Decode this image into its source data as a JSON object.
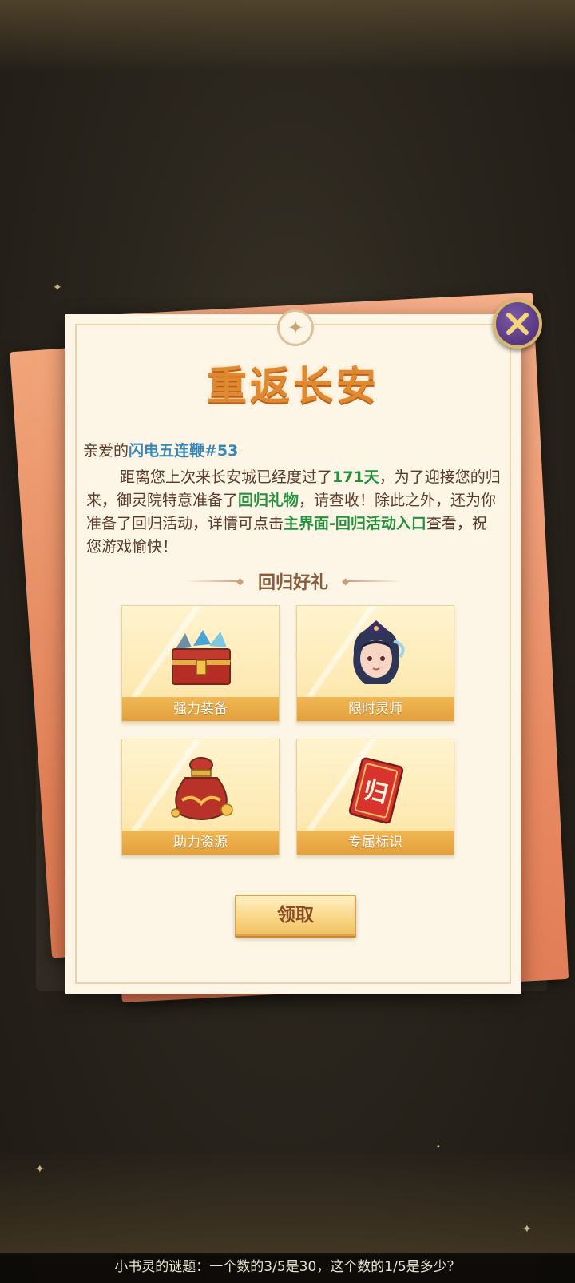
{
  "dialog": {
    "title": "重返长安",
    "greeting_prefix": "亲爱的",
    "player_name": "闪电五连鞭#53",
    "body": {
      "p1": "距离您上次来长安城已经度过了",
      "days": "171天",
      "p2": "，为了迎接您的归来，御灵院特意准备了",
      "gift": "回归礼物",
      "p3": "，请查收！除此之外，还为你准备了回归活动，详情可点击",
      "entry": "主界面-回归活动入口",
      "p4": "查看，祝您游戏愉快！"
    },
    "section_title": "回归好礼",
    "rewards": [
      {
        "label": "强力装备",
        "icon": "treasure-chest-icon"
      },
      {
        "label": "限时灵师",
        "icon": "character-portrait-icon"
      },
      {
        "label": "助力资源",
        "icon": "resource-bag-icon"
      },
      {
        "label": "专属标识",
        "icon": "red-badge-icon"
      }
    ],
    "claim_label": "领取",
    "close_icon": "close-icon"
  },
  "bottom_hint": "小书灵的谜题：一个数的3/5是30，这个数的1/5是多少？",
  "colors": {
    "title": "#e0892f",
    "highlight_green": "#25913e",
    "name_blue": "#3a86b8",
    "tile_label": "#e3a03c",
    "close_purple": "#57387f"
  }
}
